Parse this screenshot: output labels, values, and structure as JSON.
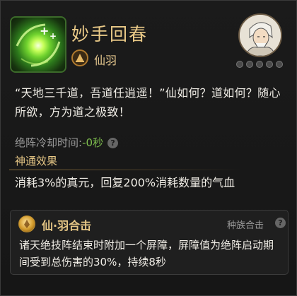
{
  "skill": {
    "name": "妙手回春",
    "sect_name": "仙羽",
    "icon": "green-glow-skill-icon"
  },
  "quote": "“天地三千道，吾道任逍遥！”仙如何？道如何？随心所欲，方为道之极致！",
  "cooldown": {
    "label": "绝阵冷却时间:",
    "value": "-0秒",
    "help_symbol": "?"
  },
  "effect": {
    "title": "神通效果",
    "description": "消耗3%的真元，回复200%消耗数量的气血"
  },
  "combo": {
    "name": "仙·羽合击",
    "type_label": "种族合击",
    "help_symbol": "?",
    "description": "诸天绝技阵结束时附加一个屏障，屏障值为绝阵启动期间受到总伤害的30%，持续8秒"
  },
  "colors": {
    "title_gold": "#e9c987",
    "cooldown_green": "#7fbf4e",
    "background": "#161616"
  }
}
